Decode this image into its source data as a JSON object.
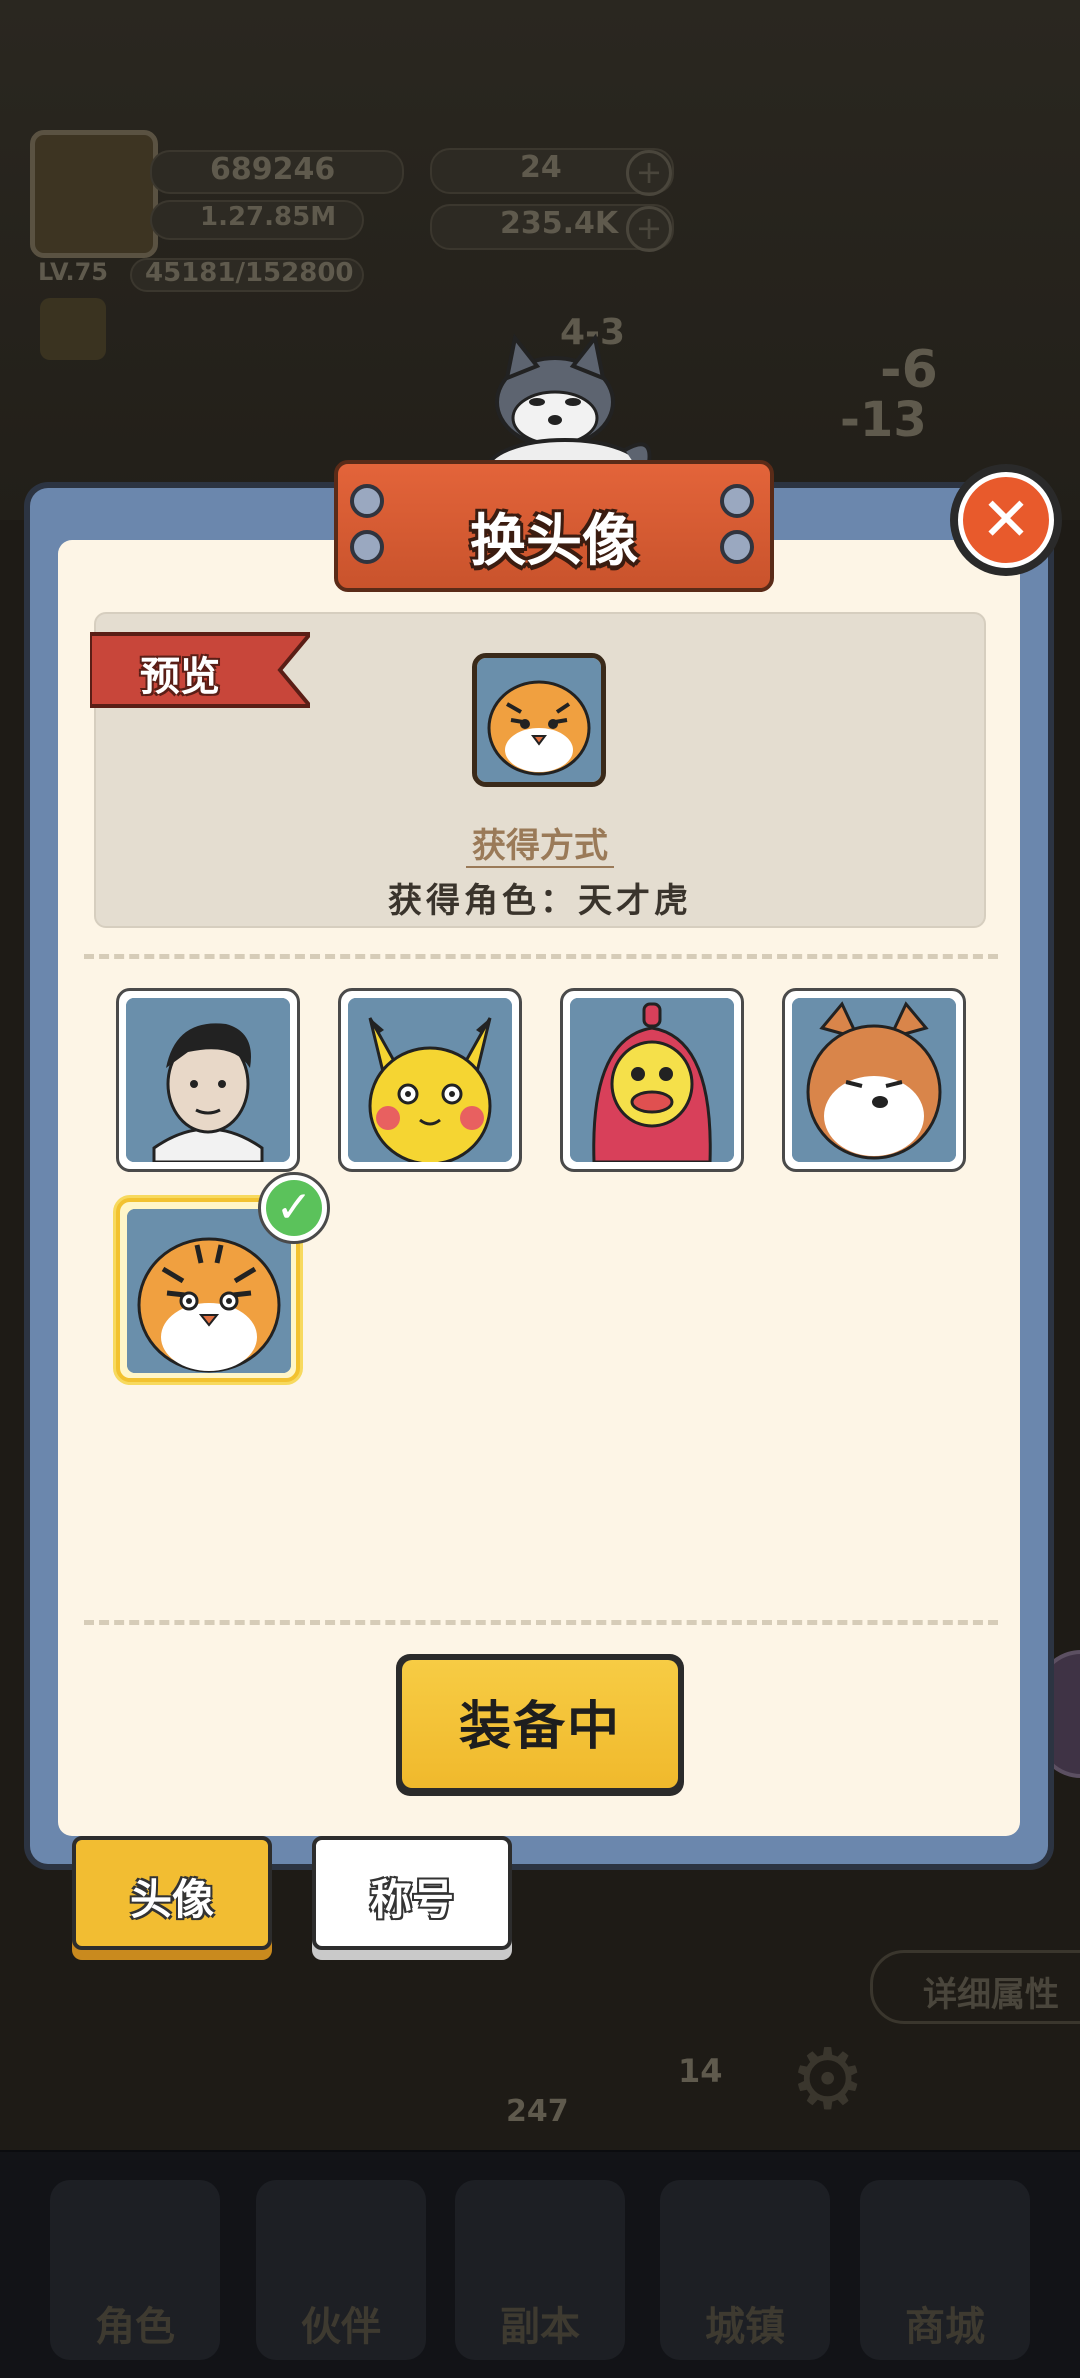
{
  "hud": {
    "power": "689246",
    "sub_stat": "1.27.85M",
    "level": "LV.75",
    "exp": "45181/152800",
    "gems": "24",
    "gold": "235.4K",
    "stage": "4-3",
    "float_1": "-6",
    "float_2": "-13",
    "detail_button": "详细属性",
    "tower_level": "247",
    "badge_count": "14"
  },
  "nav": {
    "items": [
      "角色",
      "伙伴",
      "副本",
      "城镇",
      "商城"
    ]
  },
  "modal": {
    "title": "换头像",
    "close_glyph": "✕",
    "preview": {
      "ribbon": "预览",
      "obtain_title": "获得方式",
      "obtain_line": "获得角色：天才虎"
    },
    "avatars": [
      {
        "name": "man",
        "bg": "#6a8fab",
        "selected": false
      },
      {
        "name": "pikachu",
        "bg": "#6a8fab",
        "selected": false
      },
      {
        "name": "red-puppet",
        "bg": "#6a8fab",
        "selected": false
      },
      {
        "name": "shiba",
        "bg": "#6a8fab",
        "selected": false
      },
      {
        "name": "tiger",
        "bg": "#6a8fab",
        "selected": true
      }
    ],
    "check_glyph": "✓",
    "equip_button": "装备中",
    "tabs": [
      {
        "label": "头像",
        "active": true
      },
      {
        "label": "称号",
        "active": false
      }
    ]
  },
  "colors": {
    "accent_yellow": "#f2bd32",
    "title_orange": "#e3643a",
    "panel_blue": "#6b87ad",
    "cream": "#fdf5e6"
  }
}
